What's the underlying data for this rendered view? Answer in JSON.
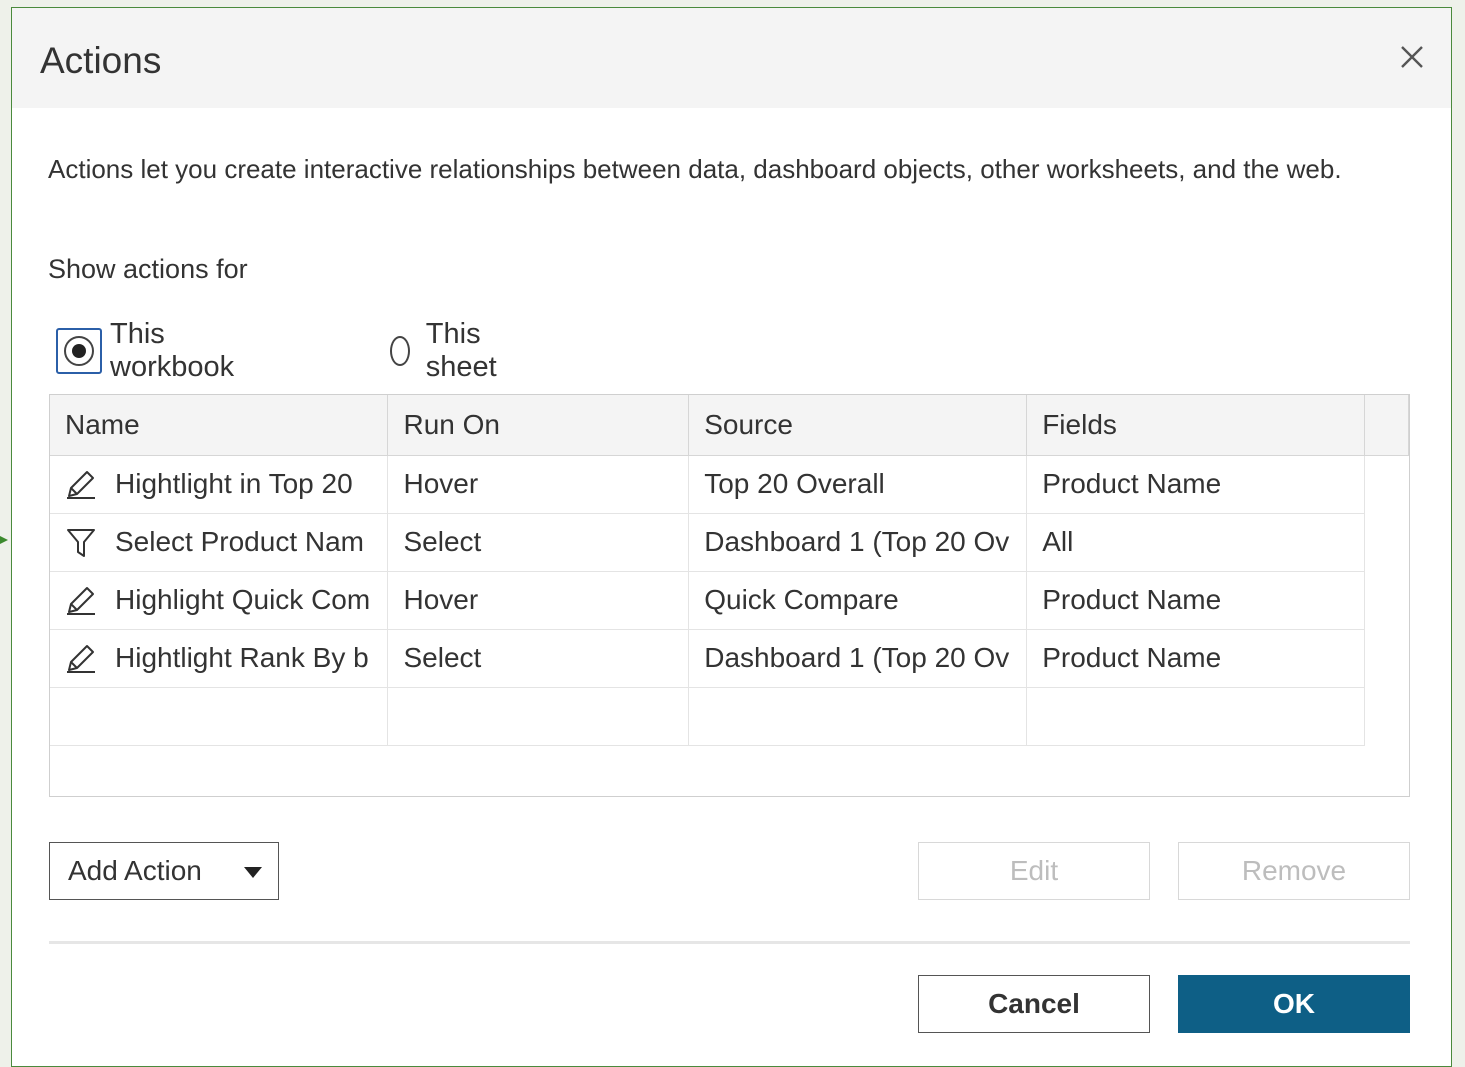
{
  "dialog": {
    "title": "Actions",
    "description": "Actions let you create interactive relationships between data, dashboard objects, other worksheets, and the web.",
    "show_actions_label": "Show actions for",
    "radio_options": [
      {
        "label": "This workbook",
        "checked": true
      },
      {
        "label": "This sheet",
        "checked": false
      }
    ]
  },
  "table": {
    "columns": [
      "Name",
      "Run On",
      "Source",
      "Fields"
    ],
    "rows": [
      {
        "icon": "pencil-icon",
        "name": "Hightlight in Top 20",
        "run_on": "Hover",
        "source": "Top 20 Overall",
        "fields": "Product Name"
      },
      {
        "icon": "filter-icon",
        "name": "Select Product Nam",
        "run_on": "Select",
        "source": "Dashboard 1 (Top 20 Ov",
        "fields": "All"
      },
      {
        "icon": "pencil-icon",
        "name": "Highlight Quick Com",
        "run_on": "Hover",
        "source": "Quick Compare",
        "fields": "Product Name"
      },
      {
        "icon": "pencil-icon",
        "name": "Hightlight Rank By b",
        "run_on": "Select",
        "source": "Dashboard 1 (Top 20 Ov",
        "fields": "Product Name"
      }
    ]
  },
  "buttons": {
    "add_action": "Add Action",
    "edit": "Edit",
    "remove": "Remove",
    "cancel": "Cancel",
    "ok": "OK"
  },
  "colors": {
    "primary": "#0e5f86",
    "frame_border": "#4a8a3c",
    "disabled_text": "#bdbdbd"
  }
}
